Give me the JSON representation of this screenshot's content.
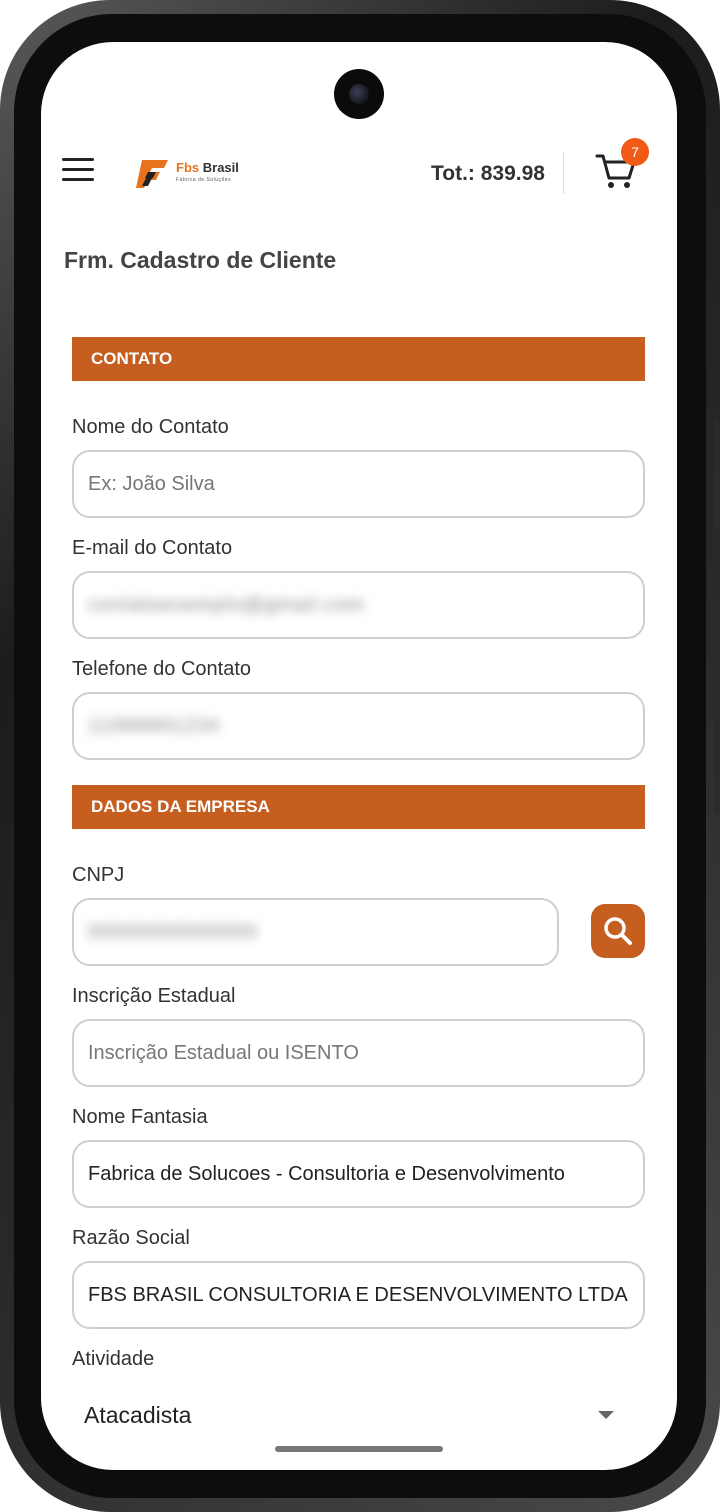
{
  "header": {
    "logo_text": "Fbs",
    "logo_text_2": "Brasil",
    "logo_subtitle": "Fábrica de Soluções",
    "total": "Tot.: 839.98",
    "cart_count": "7"
  },
  "page_title": "Frm. Cadastro de Cliente",
  "sections": {
    "contato": "CONTATO",
    "empresa": "DADOS DA EMPRESA"
  },
  "fields": {
    "nome_contato": {
      "label": "Nome do Contato",
      "placeholder": "Ex: João Silva"
    },
    "email_contato": {
      "label": "E-mail do Contato",
      "value": "contatoexemplo@gmail.com"
    },
    "telefone_contato": {
      "label": "Telefone do Contato",
      "value": "11999991234"
    },
    "cnpj": {
      "label": "CNPJ",
      "value": "00000000000000"
    },
    "inscricao_estadual": {
      "label": "Inscrição Estadual",
      "placeholder": "Inscrição Estadual ou ISENTO"
    },
    "nome_fantasia": {
      "label": "Nome Fantasia",
      "value": "Fabrica de Solucoes - Consultoria e Desenvolvimento"
    },
    "razao_social": {
      "label": "Razão Social",
      "value": "FBS BRASIL CONSULTORIA E DESENVOLVIMENTO LTDA"
    },
    "atividade": {
      "label": "Atividade",
      "value": "Atacadista"
    }
  },
  "colors": {
    "accent": "#c65e20",
    "badge": "#f05a14"
  },
  "icons": {
    "menu": "hamburger-icon",
    "cart": "cart-icon",
    "search": "search-icon",
    "dropdown": "caret-down-icon"
  }
}
